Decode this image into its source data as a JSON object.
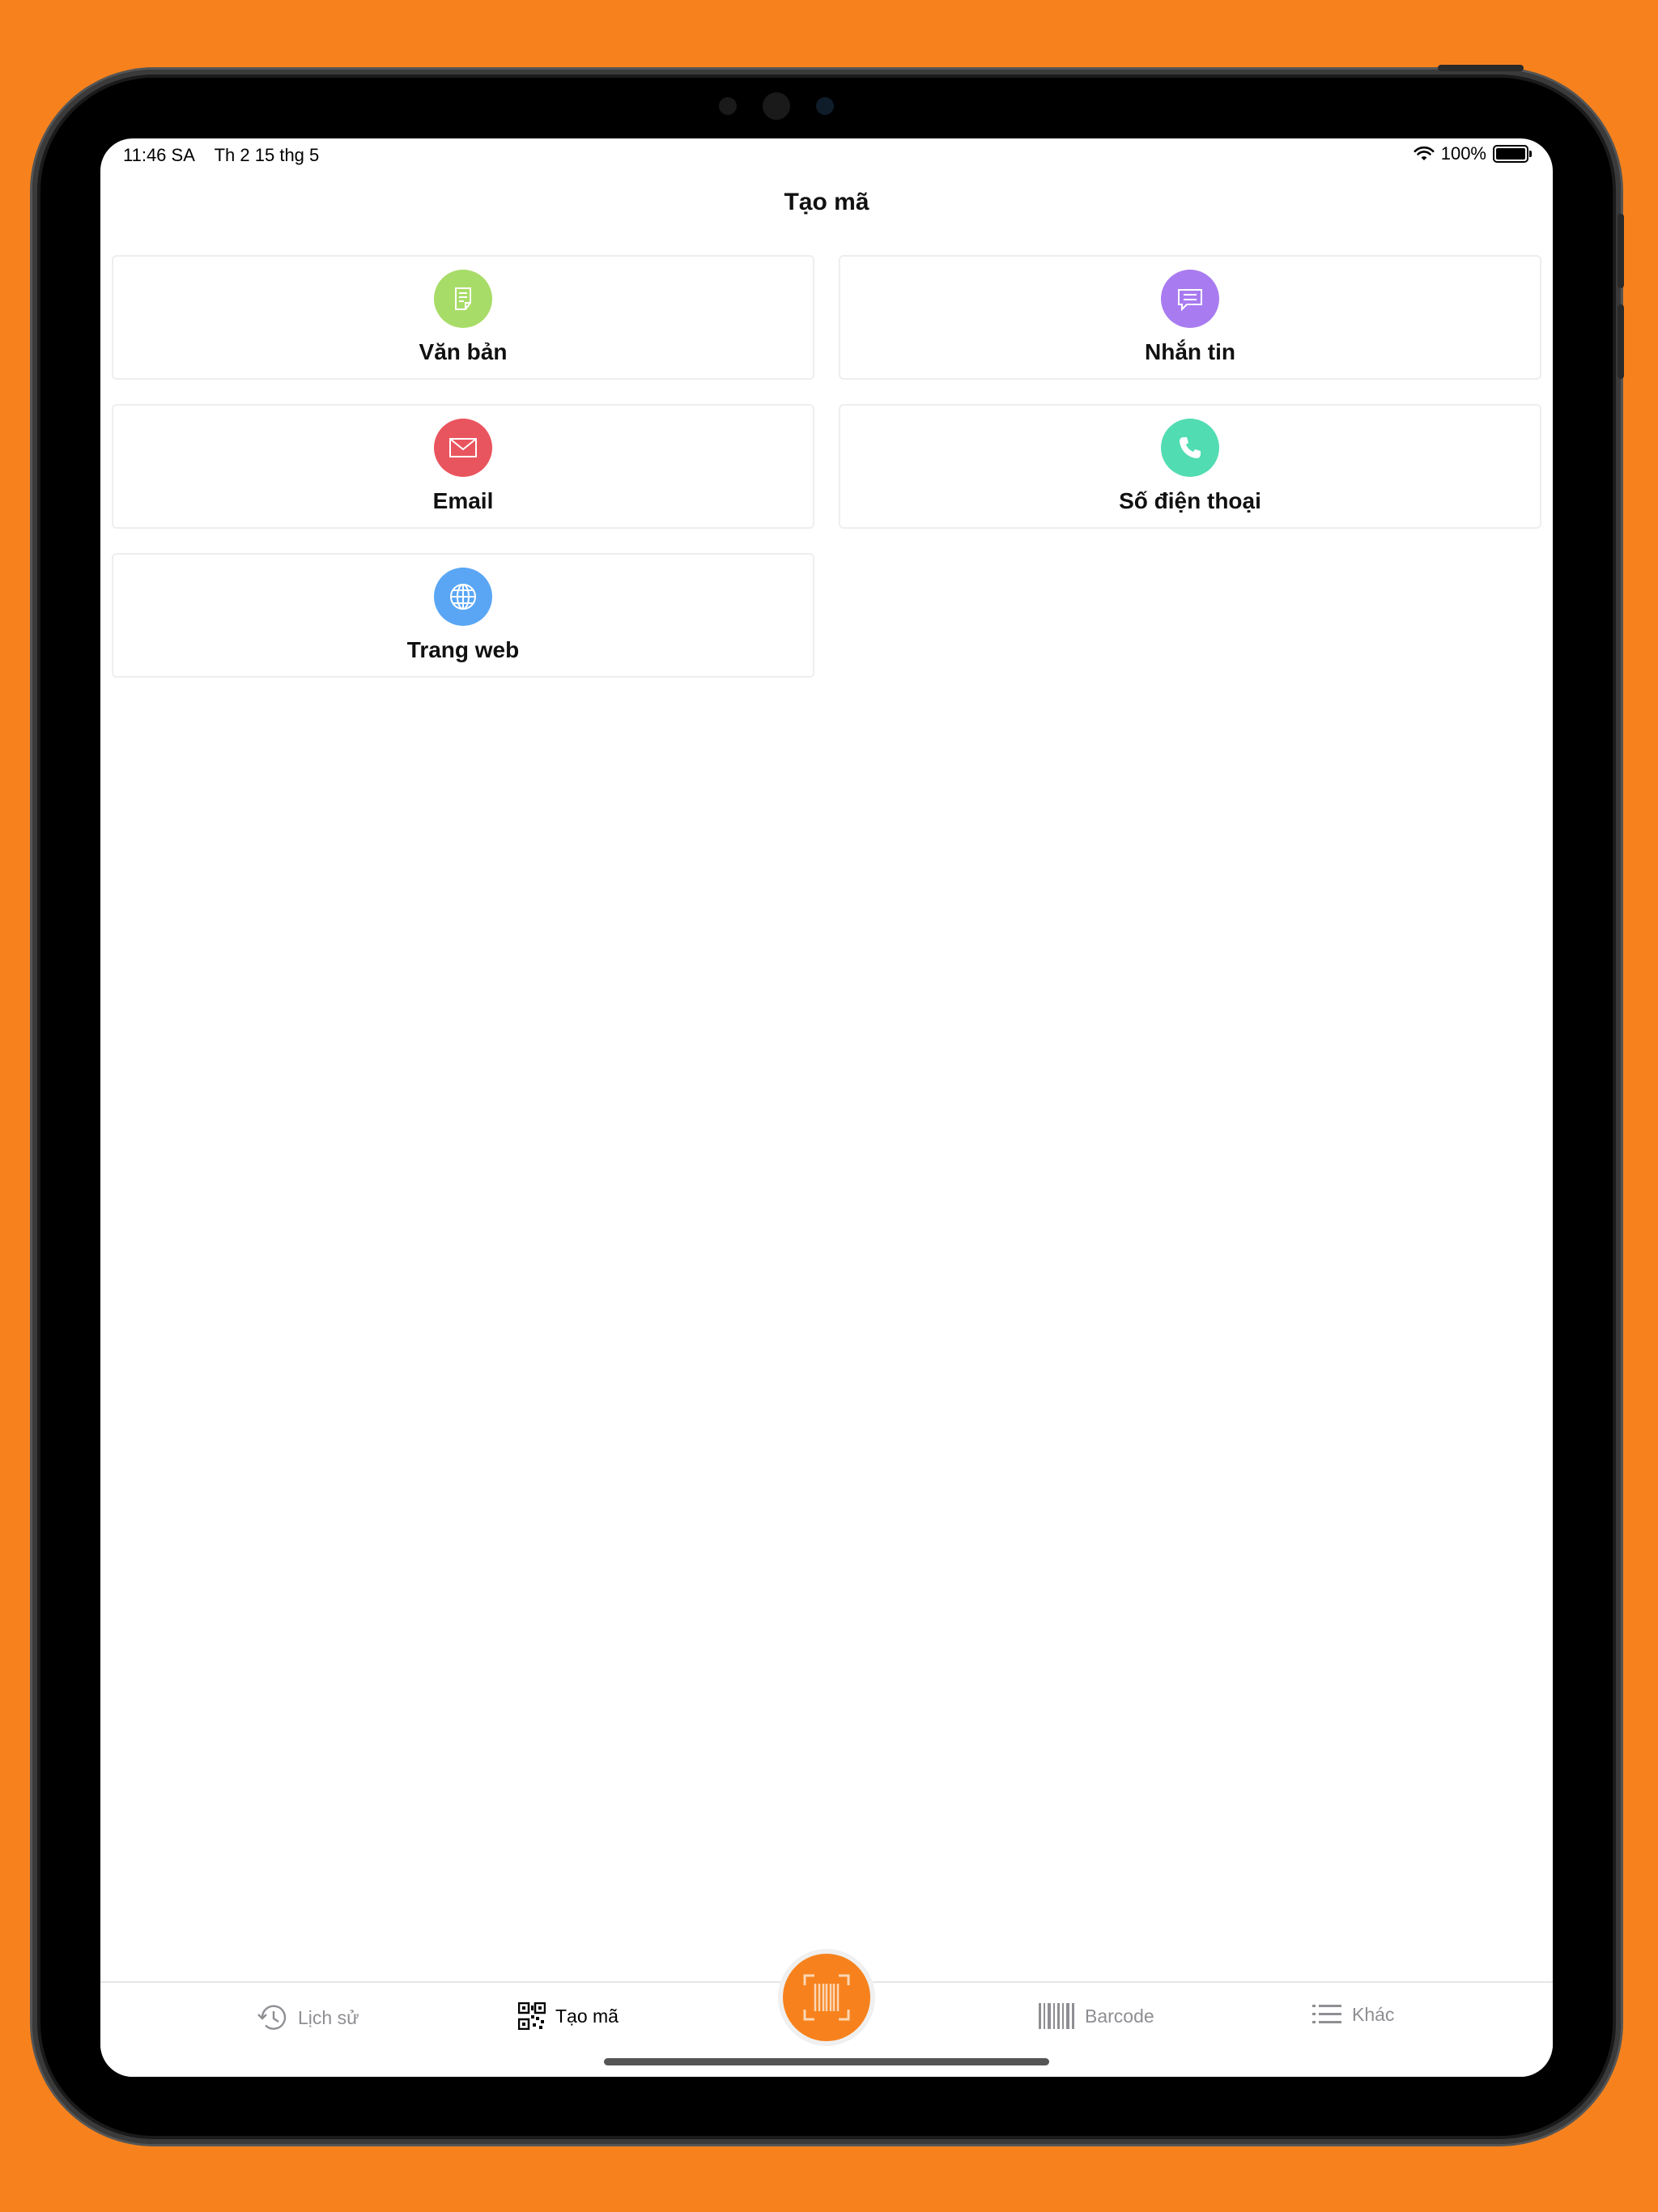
{
  "colors": {
    "background": "#f7821d",
    "accent": "#f7821d",
    "text_icon_bg": "#a8dc68",
    "sms_icon_bg": "#a97bf0",
    "email_icon_bg": "#e9555e",
    "phone_icon_bg": "#52dcb2",
    "web_icon_bg": "#5aa6f5"
  },
  "status_bar": {
    "time": "11:46 SA",
    "date": "Th 2 15 thg 5",
    "battery": "100%"
  },
  "nav": {
    "title": "Tạo mã"
  },
  "cards": [
    {
      "label": "Văn bản",
      "icon": "document-icon"
    },
    {
      "label": "Nhắn tin",
      "icon": "chat-bubble-icon"
    },
    {
      "label": "Email",
      "icon": "envelope-icon"
    },
    {
      "label": "Số điện thoại",
      "icon": "phone-icon"
    },
    {
      "label": "Trang web",
      "icon": "globe-icon"
    }
  ],
  "tabs": {
    "history": "Lịch sử",
    "create": "Tạo mã",
    "barcode": "Barcode",
    "more": "Khác"
  }
}
